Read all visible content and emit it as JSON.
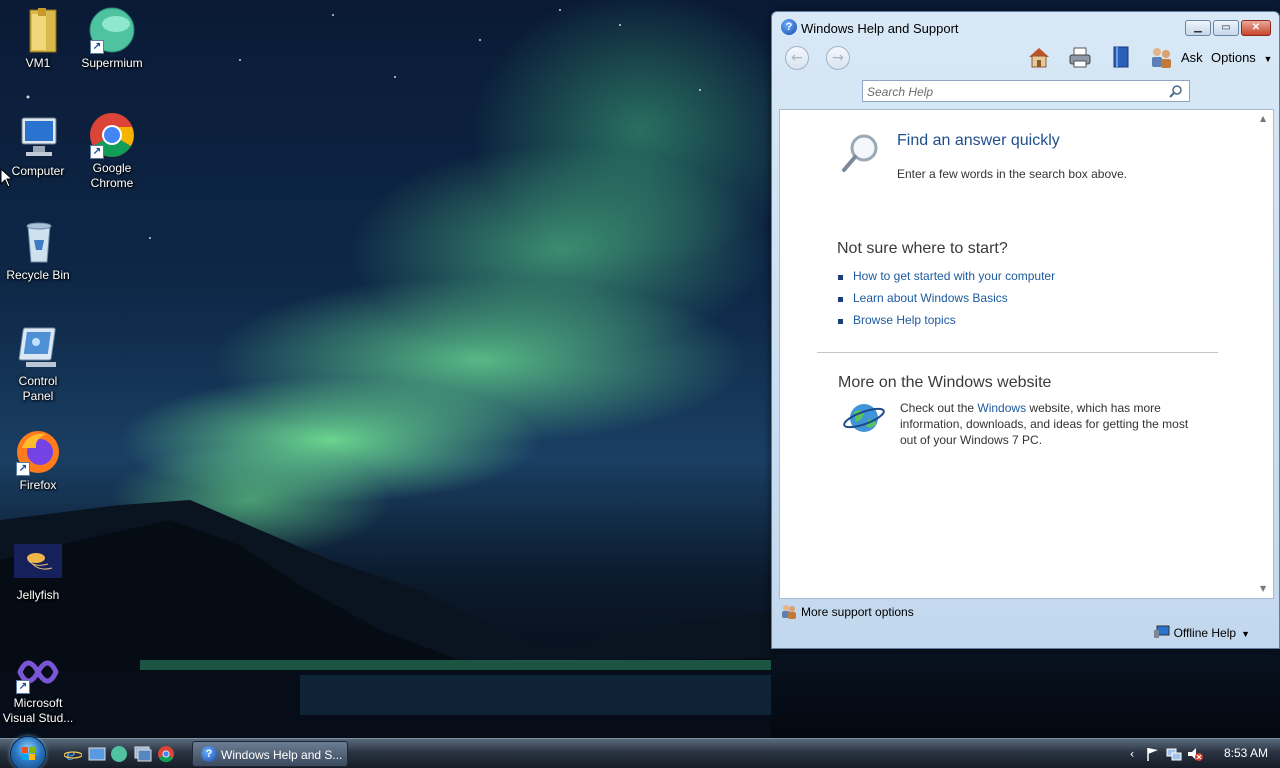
{
  "desktop": {
    "icons": [
      {
        "label": "VM1",
        "icon": "folder-icon"
      },
      {
        "label": "Supermium",
        "icon": "supermium-icon"
      },
      {
        "label": "Computer",
        "icon": "computer-icon"
      },
      {
        "label": "Google Chrome",
        "icon": "chrome-icon"
      },
      {
        "label": "Recycle Bin",
        "icon": "recycle-bin-icon"
      },
      {
        "label": "Control Panel",
        "icon": "control-panel-icon"
      },
      {
        "label": "Firefox",
        "icon": "firefox-icon"
      },
      {
        "label": "Jellyfish",
        "icon": "jellyfish-icon"
      },
      {
        "label": "Microsoft Visual Stud...",
        "icon": "visual-studio-icon"
      }
    ]
  },
  "help_window": {
    "title": "Windows Help and Support",
    "toolbar": {
      "ask_label": "Ask",
      "options_label": "Options"
    },
    "search": {
      "placeholder": "Search Help",
      "value": ""
    },
    "find": {
      "title": "Find an answer quickly",
      "description": "Enter a few words in the search box above."
    },
    "not_sure": {
      "title": "Not sure where to start?",
      "links": [
        "How to get started with your computer",
        "Learn about Windows Basics",
        "Browse Help topics"
      ]
    },
    "more": {
      "title": "More on the Windows website",
      "body_before": "Check out the ",
      "link": "Windows",
      "body_after": " website, which has more information, downloads, and ideas for getting the most out of your Windows 7 PC."
    },
    "footer": {
      "more_support": "More support options",
      "offline_help": "Offline Help"
    }
  },
  "taskbar": {
    "task_label": "Windows Help and S...",
    "clock": "8:53 AM"
  },
  "colors": {
    "link": "#1c5a9e",
    "heading_blue": "#1f4e8c",
    "window_frame": "#c2d8ee"
  }
}
